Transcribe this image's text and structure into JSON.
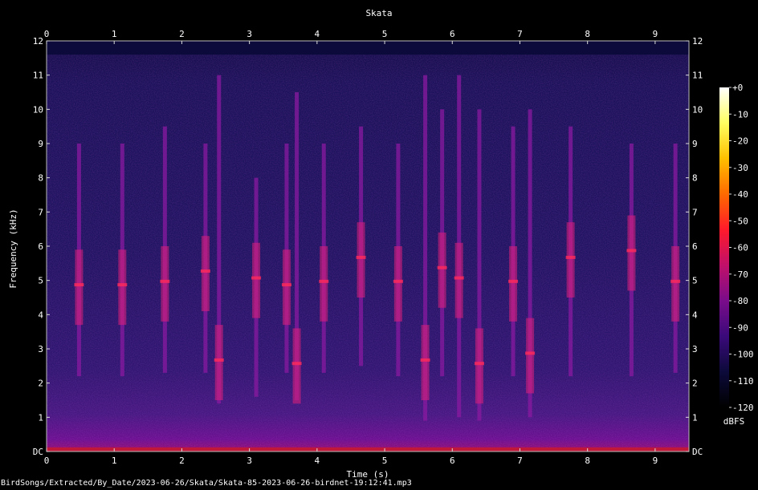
{
  "chart_data": {
    "type": "heatmap",
    "subtype": "spectrogram",
    "title": "Skata",
    "xlabel": "Time (s)",
    "ylabel": "Frequency (kHz)",
    "xlim": [
      0,
      9.5
    ],
    "ylim": [
      0,
      12
    ],
    "x_ticks": [
      "0",
      "1",
      "2",
      "3",
      "4",
      "5",
      "6",
      "7",
      "8",
      "9"
    ],
    "y_ticks": [
      "DC",
      "1",
      "2",
      "3",
      "4",
      "5",
      "6",
      "7",
      "8",
      "9",
      "10",
      "11",
      "12"
    ],
    "colorbar": {
      "label": "dBFS",
      "ticks": [
        "+0",
        "-10",
        "-20",
        "-30",
        "-40",
        "-50",
        "-60",
        "-70",
        "-80",
        "-90",
        "-100",
        "-110",
        "-120"
      ],
      "range": [
        -120,
        0
      ],
      "colors": [
        "#000000",
        "#0c0a3a",
        "#3a0a7a",
        "#7a0c8a",
        "#c0106a",
        "#ff1a2a",
        "#ff6a00",
        "#ffc000",
        "#ffff60",
        "#ffffff"
      ]
    },
    "calls": [
      {
        "t": 0.48,
        "f_low": 2.2,
        "f_high": 9.0,
        "peak_khz": 4.8
      },
      {
        "t": 1.12,
        "f_low": 2.2,
        "f_high": 9.0,
        "peak_khz": 4.8
      },
      {
        "t": 1.75,
        "f_low": 2.3,
        "f_high": 9.5,
        "peak_khz": 4.9
      },
      {
        "t": 2.35,
        "f_low": 2.3,
        "f_high": 9.0,
        "peak_khz": 5.2
      },
      {
        "t": 2.55,
        "f_low": 1.4,
        "f_high": 11.0,
        "peak_khz": 2.6
      },
      {
        "t": 3.1,
        "f_low": 1.6,
        "f_high": 8.0,
        "peak_khz": 5.0
      },
      {
        "t": 3.55,
        "f_low": 2.3,
        "f_high": 9.0,
        "peak_khz": 4.8
      },
      {
        "t": 3.7,
        "f_low": 1.5,
        "f_high": 10.5,
        "peak_khz": 2.5
      },
      {
        "t": 4.1,
        "f_low": 2.3,
        "f_high": 9.0,
        "peak_khz": 4.9
      },
      {
        "t": 4.65,
        "f_low": 2.5,
        "f_high": 9.5,
        "peak_khz": 5.6
      },
      {
        "t": 5.2,
        "f_low": 2.2,
        "f_high": 9.0,
        "peak_khz": 4.9
      },
      {
        "t": 5.6,
        "f_low": 0.9,
        "f_high": 11.0,
        "peak_khz": 2.6
      },
      {
        "t": 5.85,
        "f_low": 2.2,
        "f_high": 10.0,
        "peak_khz": 5.3
      },
      {
        "t": 6.1,
        "f_low": 1.0,
        "f_high": 11.0,
        "peak_khz": 5.0
      },
      {
        "t": 6.4,
        "f_low": 0.9,
        "f_high": 10.0,
        "peak_khz": 2.5
      },
      {
        "t": 6.9,
        "f_low": 2.2,
        "f_high": 9.5,
        "peak_khz": 4.9
      },
      {
        "t": 7.15,
        "f_low": 1.0,
        "f_high": 10.0,
        "peak_khz": 2.8
      },
      {
        "t": 7.75,
        "f_low": 2.2,
        "f_high": 9.5,
        "peak_khz": 5.6
      },
      {
        "t": 8.65,
        "f_low": 2.2,
        "f_high": 9.0,
        "peak_khz": 5.8
      },
      {
        "t": 9.3,
        "f_low": 2.3,
        "f_high": 9.0,
        "peak_khz": 4.9
      }
    ]
  },
  "footer": {
    "source": "BirdSongs/Extracted/By_Date/2023-06-26/Skata/Skata-85-2023-06-26-birdnet-19:12:41.mp3"
  }
}
